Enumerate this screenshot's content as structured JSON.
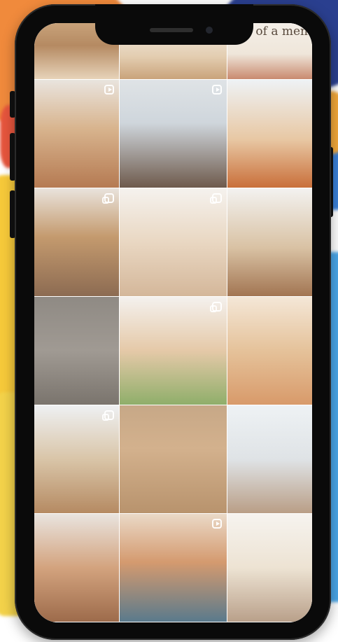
{
  "feed": {
    "tiles": [
      {
        "id": "t0",
        "bg": "linear-gradient(180deg,#c8a27a 0%,#b58a62 40%,#e7d3b9 100%)",
        "icon": ""
      },
      {
        "id": "t1",
        "bg": "linear-gradient(180deg,#f2ede6 0%,#e3cdb0 60%,#c9a37b 100%)",
        "icon": ""
      },
      {
        "id": "t2",
        "bg": "linear-gradient(180deg,#f4efe8 0%,#efe6da 55%,#c98a6f 100%)",
        "icon": "",
        "caption": "of a men"
      },
      {
        "id": "t3",
        "bg": "linear-gradient(180deg,#e9e4de 0%,#d8b48e 45%,#b57a52 100%)",
        "icon": "reel"
      },
      {
        "id": "t4",
        "bg": "linear-gradient(180deg,#dfe3e6 0%,#cfd6dc 40%,#6e5a4c 100%)",
        "icon": "reel"
      },
      {
        "id": "t5",
        "bg": "linear-gradient(180deg,#eef2f5 0%,#e8c8a4 55%,#c96f3a 100%)",
        "icon": ""
      },
      {
        "id": "t6",
        "bg": "linear-gradient(180deg,#e9e3dc 0%,#c49a6e 45%,#8c6b52 100%)",
        "icon": "multi"
      },
      {
        "id": "t7",
        "bg": "linear-gradient(180deg,#f5f2ee 0%,#e9d7c2 50%,#d4b79a 100%)",
        "icon": "multi"
      },
      {
        "id": "t8",
        "bg": "linear-gradient(180deg,#f3f2f0 0%,#d9c2a4 55%,#a27552 100%)",
        "icon": ""
      },
      {
        "id": "t9",
        "bg": "linear-gradient(180deg,#8f8a84 0%,#a09a93 50%,#7a746d 100%)",
        "icon": ""
      },
      {
        "id": "t10",
        "bg": "linear-gradient(180deg,#f4f1ee 0%,#e5c9a8 50%,#8fae6a 100%)",
        "icon": "multi"
      },
      {
        "id": "t11",
        "bg": "linear-gradient(180deg,#f4e7d7 0%,#e5c29a 50%,#d89a6a 100%)",
        "icon": ""
      },
      {
        "id": "t12",
        "bg": "linear-gradient(180deg,#eef0f2 0%,#d9c5a8 50%,#b58a62 100%)",
        "icon": "multi"
      },
      {
        "id": "t13",
        "bg": "linear-gradient(180deg,#c7a887 0%,#d3b18d 40%,#b8936d 100%)",
        "icon": ""
      },
      {
        "id": "t14",
        "bg": "linear-gradient(180deg,#eef2f4 0%,#dfe3e6 50%,#b99e86 100%)",
        "icon": ""
      },
      {
        "id": "t15",
        "bg": "linear-gradient(180deg,#e9e4df 0%,#d3a37e 50%,#9d6b4b 100%)",
        "icon": ""
      },
      {
        "id": "t16",
        "bg": "linear-gradient(180deg,#ead9c7 0%,#d49a6f 45%,#5a7a8c 100%)",
        "icon": "reel"
      },
      {
        "id": "t17",
        "bg": "linear-gradient(180deg,#f6f3ef 0%,#ede3d3 50%,#b9a08a 100%)",
        "icon": ""
      }
    ]
  },
  "colors": {
    "phone_body": "#0a0a0a",
    "screen_bg": "#ffffff"
  }
}
